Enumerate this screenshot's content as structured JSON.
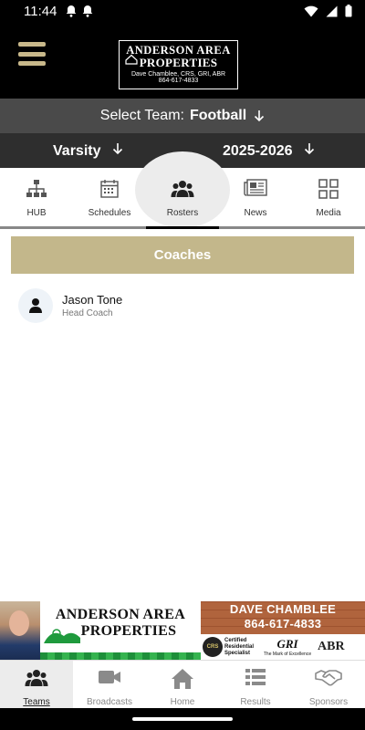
{
  "status_bar": {
    "time": "11:44"
  },
  "header": {
    "logo": {
      "line1": "ANDERSON AREA",
      "line2": "PROPERTIES",
      "line3": "Dave Chamblee, CRS, GRI, ABR",
      "line4": "864-617-4833"
    }
  },
  "team_select": {
    "label": "Select Team:",
    "value": "Football"
  },
  "level_bar": {
    "level": "Varsity",
    "season": "2025-2026"
  },
  "tabs": [
    {
      "label": "HUB",
      "icon": "hub-icon"
    },
    {
      "label": "Schedules",
      "icon": "calendar-icon"
    },
    {
      "label": "Rosters",
      "icon": "people-icon",
      "active": true
    },
    {
      "label": "News",
      "icon": "newspaper-icon"
    },
    {
      "label": "Media",
      "icon": "grid-icon"
    }
  ],
  "roster": {
    "section_title": "Coaches",
    "people": [
      {
        "name": "Jason Tone",
        "role": "Head Coach"
      }
    ]
  },
  "ad": {
    "brand_line1": "ANDERSON AREA",
    "brand_line2": "PROPERTIES",
    "agent_name": "DAVE CHAMBLEE",
    "agent_phone": "864-617-4833",
    "crs": "CRS",
    "crs_text": "Certified Residential Specialist",
    "gri": "GRI",
    "gri_text": "The Mark of Excellence",
    "abr": "ABR"
  },
  "bottom_nav": [
    {
      "label": "Teams",
      "icon": "teams-icon",
      "active": true
    },
    {
      "label": "Broadcasts",
      "icon": "video-camera-icon"
    },
    {
      "label": "Home",
      "icon": "home-icon"
    },
    {
      "label": "Results",
      "icon": "results-list-icon"
    },
    {
      "label": "Sponsors",
      "icon": "handshake-icon"
    }
  ],
  "colors": {
    "accent_gold": "#c3b78b",
    "header_bg": "#000000",
    "team_bar_bg": "#4a4a4a",
    "level_bar_bg": "#2e2e2e"
  }
}
